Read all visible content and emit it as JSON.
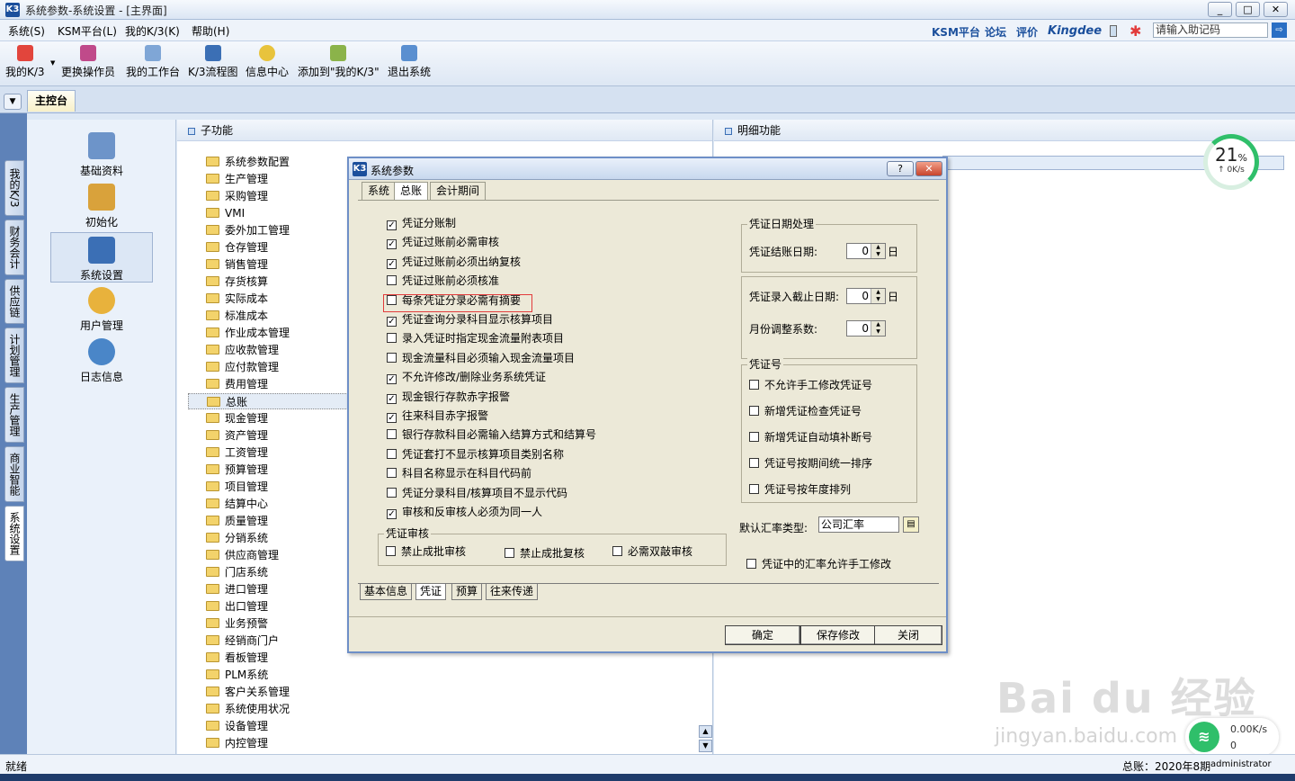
{
  "window": {
    "title": "系统参数-系统设置 - [主界面]",
    "app_icon": "K3",
    "min": "_",
    "max": "□",
    "close": "✕"
  },
  "menu": {
    "items": [
      "系统(S)",
      "KSM平台(L)",
      "我的K/3(K)",
      "帮助(H)"
    ],
    "links": [
      "KSM平台",
      "论坛",
      "评价"
    ],
    "brand": "Kingdee",
    "assist_placeholder": "请输入助记码",
    "go": "⇨"
  },
  "toolbar": {
    "items": [
      "我的K/3",
      "更换操作员",
      "我的工作台",
      "K/3流程图",
      "信息中心",
      "添加到\"我的K/3\"",
      "退出系统"
    ]
  },
  "tabs": {
    "main": "主控台",
    "drop": "▼"
  },
  "vtabs": [
    "我的K/3",
    "财务会计",
    "供应链",
    "计划管理",
    "生产管理",
    "商业智能",
    "系统设置"
  ],
  "nav": {
    "items": [
      "基础资料",
      "初始化",
      "系统设置",
      "用户管理",
      "日志信息"
    ]
  },
  "subfunc": {
    "header": "子功能",
    "items": [
      "系统参数配置",
      "生产管理",
      "采购管理",
      "VMI",
      "委外加工管理",
      "仓存管理",
      "销售管理",
      "存货核算",
      "实际成本",
      "标准成本",
      "作业成本管理",
      "应收款管理",
      "应付款管理",
      "费用管理",
      "总账",
      "现金管理",
      "资产管理",
      "工资管理",
      "预算管理",
      "项目管理",
      "结算中心",
      "质量管理",
      "分销系统",
      "供应商管理",
      "门店系统",
      "进口管理",
      "出口管理",
      "业务预警",
      "经销商门户",
      "看板管理",
      "PLM系统",
      "客户关系管理",
      "系统使用状况",
      "设备管理",
      "内控管理"
    ],
    "up": "▲",
    "down": "▼"
  },
  "detail": {
    "header": "明细功能",
    "speed_pct": "21",
    "pct_sign": "%",
    "speed_kb": "↑ 0K/s"
  },
  "dialog": {
    "title": "系统参数",
    "help": "?",
    "close": "✕",
    "top_tabs": [
      "系统",
      "总账",
      "会计期间"
    ],
    "options": [
      {
        "label": "凭证分账制",
        "checked": "✓"
      },
      {
        "label": "凭证过账前必需审核",
        "checked": "✓"
      },
      {
        "label": "凭证过账前必须出纳复核",
        "checked": "✓"
      },
      {
        "label": "凭证过账前必须核准",
        "checked": ""
      },
      {
        "label": "每条凭证分录必需有摘要",
        "checked": ""
      },
      {
        "label": "凭证查询分录科目显示核算项目",
        "checked": "✓"
      },
      {
        "label": "录入凭证时指定现金流量附表项目",
        "checked": ""
      },
      {
        "label": "现金流量科目必须输入现金流量项目",
        "checked": ""
      },
      {
        "label": "不允许修改/删除业务系统凭证",
        "checked": "✓"
      },
      {
        "label": "现金银行存款赤字报警",
        "checked": "✓"
      },
      {
        "label": "往来科目赤字报警",
        "checked": "✓"
      },
      {
        "label": "银行存款科目必需输入结算方式和结算号",
        "checked": ""
      },
      {
        "label": "凭证套打不显示核算项目类别名称",
        "checked": ""
      },
      {
        "label": "科目名称显示在科目代码前",
        "checked": ""
      },
      {
        "label": "凭证分录科目/核算项目不显示代码",
        "checked": ""
      },
      {
        "label": "审核和反审核人必须为同一人",
        "checked": "✓"
      }
    ],
    "audit_group": {
      "title": "凭证审核",
      "items": [
        "禁止成批审核",
        "禁止成批复核",
        "必需双敲审核"
      ]
    },
    "date_group": {
      "title": "凭证日期处理",
      "close_day_label": "凭证结账日期:",
      "close_day_value": "0",
      "entry_day_label": "凭证录入截止日期:",
      "entry_day_value": "0",
      "month_adj_label": "月份调整系数:",
      "month_adj_value": "0",
      "unit": "日"
    },
    "voucher_no_group": {
      "title": "凭证号",
      "items": [
        "不允许手工修改凭证号",
        "新增凭证检查凭证号",
        "新增凭证自动填补断号",
        "凭证号按期间统一排序",
        "凭证号按年度排列"
      ]
    },
    "rate_type": {
      "label": "默认汇率类型:",
      "value": "公司汇率",
      "btn": "▤"
    },
    "rate_manual": "凭证中的汇率允许手工修改",
    "bottom_tabs": [
      "基本信息",
      "凭证",
      "预算",
      "往来传递"
    ],
    "buttons": [
      "确定",
      "保存修改",
      "关闭"
    ]
  },
  "status": {
    "left": "就绪",
    "period": "总账：2020年8期",
    "user": "administrator"
  },
  "watermark": {
    "main": "Bai du 经验",
    "sub": "jingyan.baidu.com"
  },
  "net": {
    "icon": "≋",
    "up": "0.00K/s",
    "down": "0"
  },
  "colors": {
    "accent": "#1b4f9c",
    "highlight": "#e23b3b",
    "speed": "#2fbf6a"
  }
}
